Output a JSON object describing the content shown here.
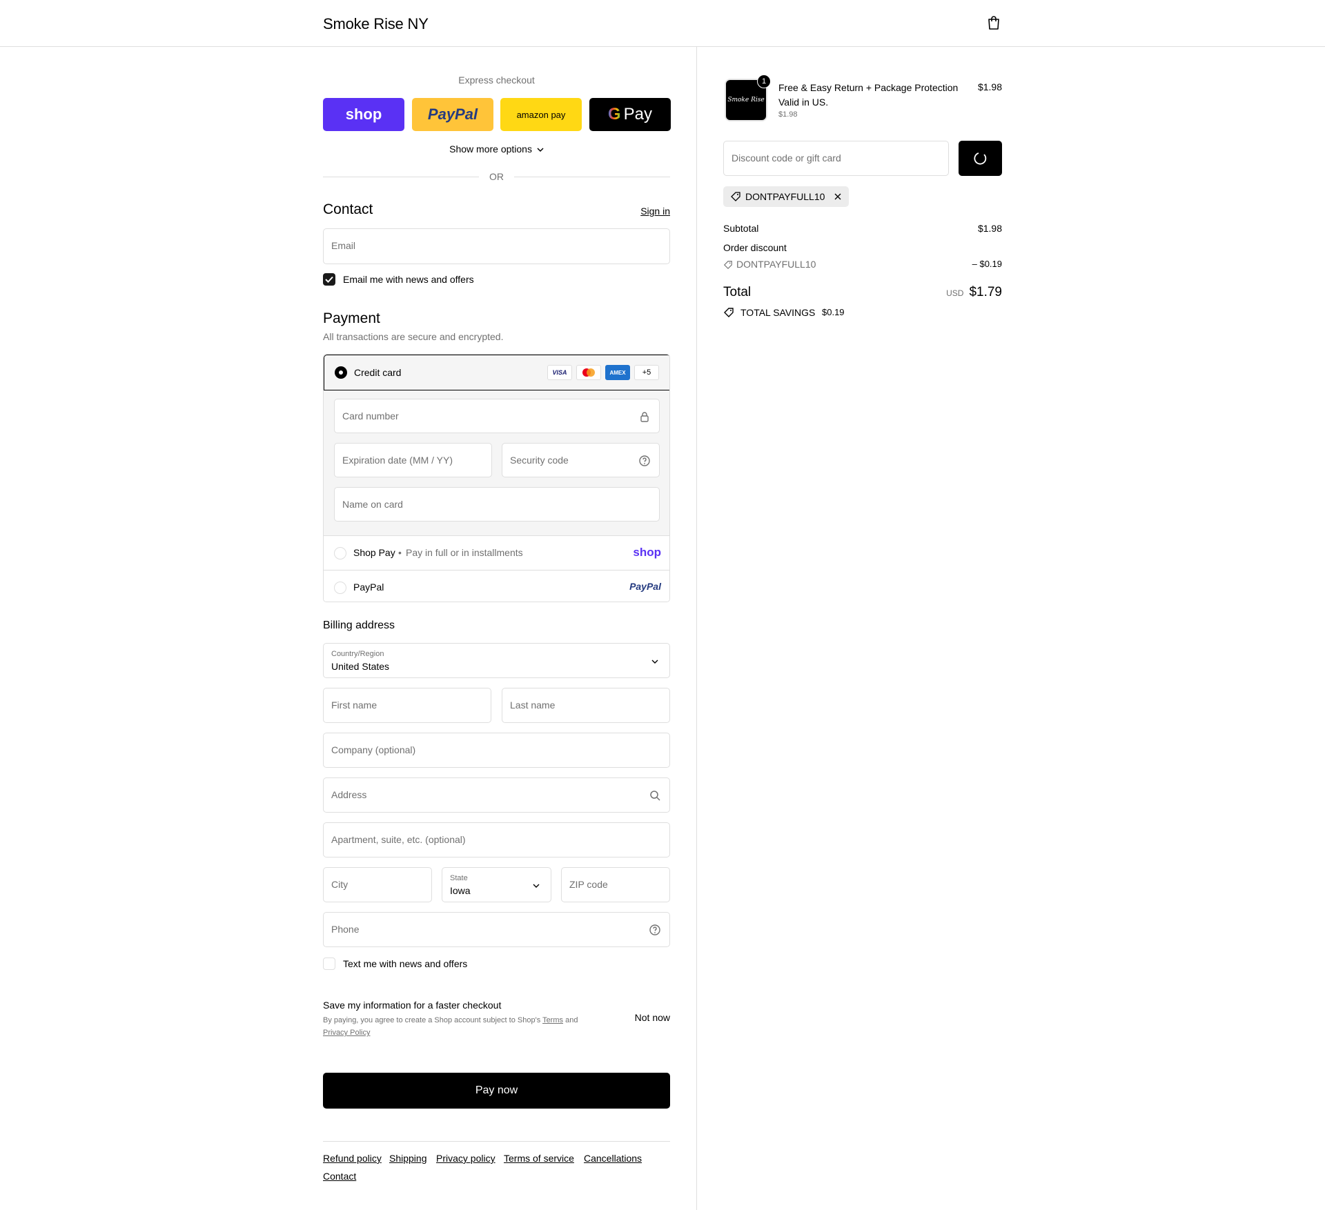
{
  "header": {
    "brand": "Smoke Rise NY",
    "cart_icon": "shopping-bag-icon"
  },
  "express": {
    "label": "Express checkout",
    "buttons": [
      "shop",
      "PayPal",
      "amazon pay",
      "Pay"
    ],
    "show_more": "Show more options",
    "or": "OR"
  },
  "contact": {
    "title": "Contact",
    "sign_in": "Sign in",
    "email_placeholder": "Email",
    "newsletter_label": "Email me with news and offers",
    "newsletter_checked": true
  },
  "payment": {
    "title": "Payment",
    "subtitle": "All transactions are secure and encrypted.",
    "credit_card_label": "Credit card",
    "card_brands": [
      "VISA",
      "Mastercard",
      "AMEX",
      "+5"
    ],
    "card_number_placeholder": "Card number",
    "expiry_placeholder": "Expiration date (MM / YY)",
    "security_placeholder": "Security code",
    "name_placeholder": "Name on card",
    "shop_pay_label": "Shop Pay",
    "shop_pay_sub": "Pay in full or in installments",
    "shop_pay_logo": "shop",
    "paypal_label": "PayPal",
    "paypal_logo": "PayPal"
  },
  "billing": {
    "title": "Billing address",
    "country_label": "Country/Region",
    "country_value": "United States",
    "first_name": "First name",
    "last_name": "Last name",
    "company": "Company (optional)",
    "address": "Address",
    "apartment": "Apartment, suite, etc. (optional)",
    "city": "City",
    "state_label": "State",
    "state_value": "Iowa",
    "zip": "ZIP code",
    "phone": "Phone",
    "sms_label": "Text me with news and offers",
    "sms_checked": false
  },
  "save_info": {
    "title": "Save my information for a faster checkout",
    "terms_prefix": "By paying, you agree to create a Shop account subject to Shop's",
    "terms_link": "Terms",
    "and": "and",
    "privacy_link": "Privacy Policy",
    "not_now": "Not now"
  },
  "pay_now": "Pay now",
  "footer_links": [
    "Refund policy",
    "Shipping",
    "Privacy policy",
    "Terms of service",
    "Cancellations",
    "Contact"
  ],
  "summary": {
    "item_name_line1": "Free & Easy Return + Package Protection",
    "item_name_line2": "Valid in US.",
    "item_unit_price": "$1.98",
    "item_price": "$1.98",
    "item_qty": "1",
    "thumb_text": "Smoke Rise",
    "discount_placeholder": "Discount code or gift card",
    "applied_code": "DONTPAYFULL10",
    "subtotal_label": "Subtotal",
    "subtotal_value": "$1.98",
    "order_discount_label": "Order discount",
    "order_discount_code": "DONTPAYFULL10",
    "order_discount_value": "– $0.19",
    "total_label": "Total",
    "currency": "USD",
    "total_value": "$1.79",
    "savings_label": "TOTAL SAVINGS",
    "savings_value": "$0.19"
  },
  "colors": {
    "shop": "#5a31f4",
    "paypal": "#ffc439",
    "amazon": "#ffd814",
    "primary": "#000000",
    "border": "#dedede"
  }
}
